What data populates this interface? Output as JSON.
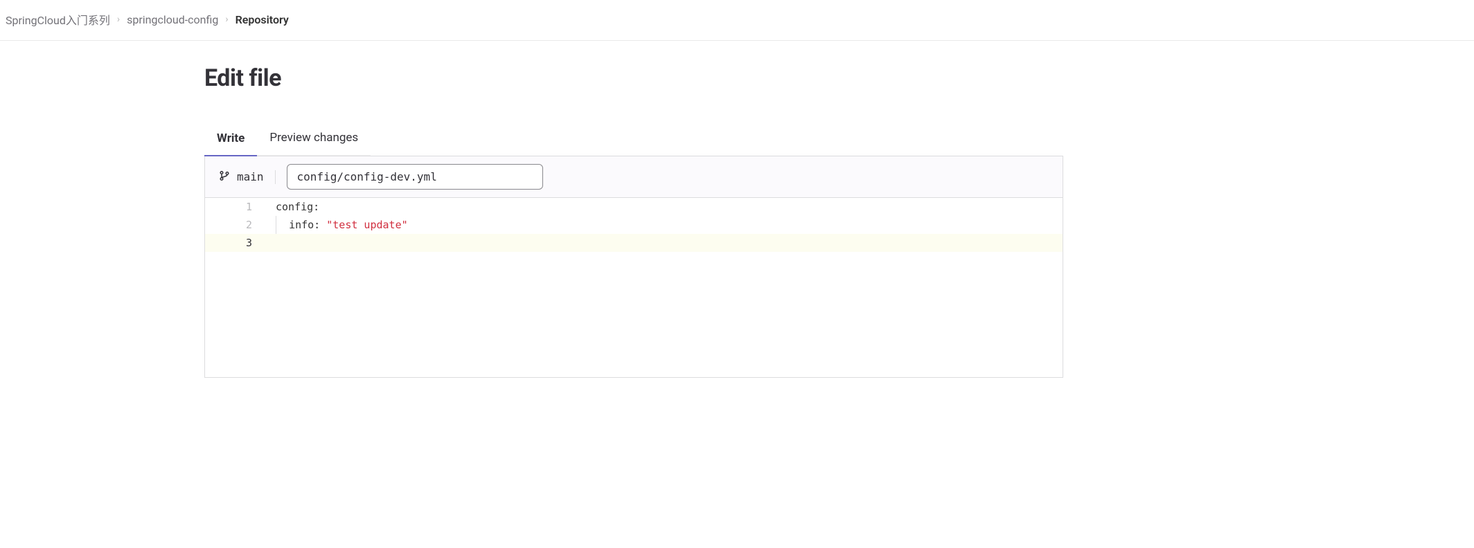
{
  "breadcrumb": {
    "items": [
      {
        "label": "SpringCloud入门系列"
      },
      {
        "label": "springcloud-config"
      },
      {
        "label": "Repository",
        "current": true
      }
    ]
  },
  "page": {
    "title": "Edit file"
  },
  "tabs": {
    "write": "Write",
    "preview": "Preview changes"
  },
  "toolbar": {
    "branch": "main",
    "filepath": "config/config-dev.yml"
  },
  "editor": {
    "lines": [
      {
        "num": "1",
        "key": "config:",
        "str": ""
      },
      {
        "num": "2",
        "key": "info: ",
        "str": "\"test update\""
      },
      {
        "num": "3",
        "key": "",
        "str": ""
      }
    ]
  }
}
